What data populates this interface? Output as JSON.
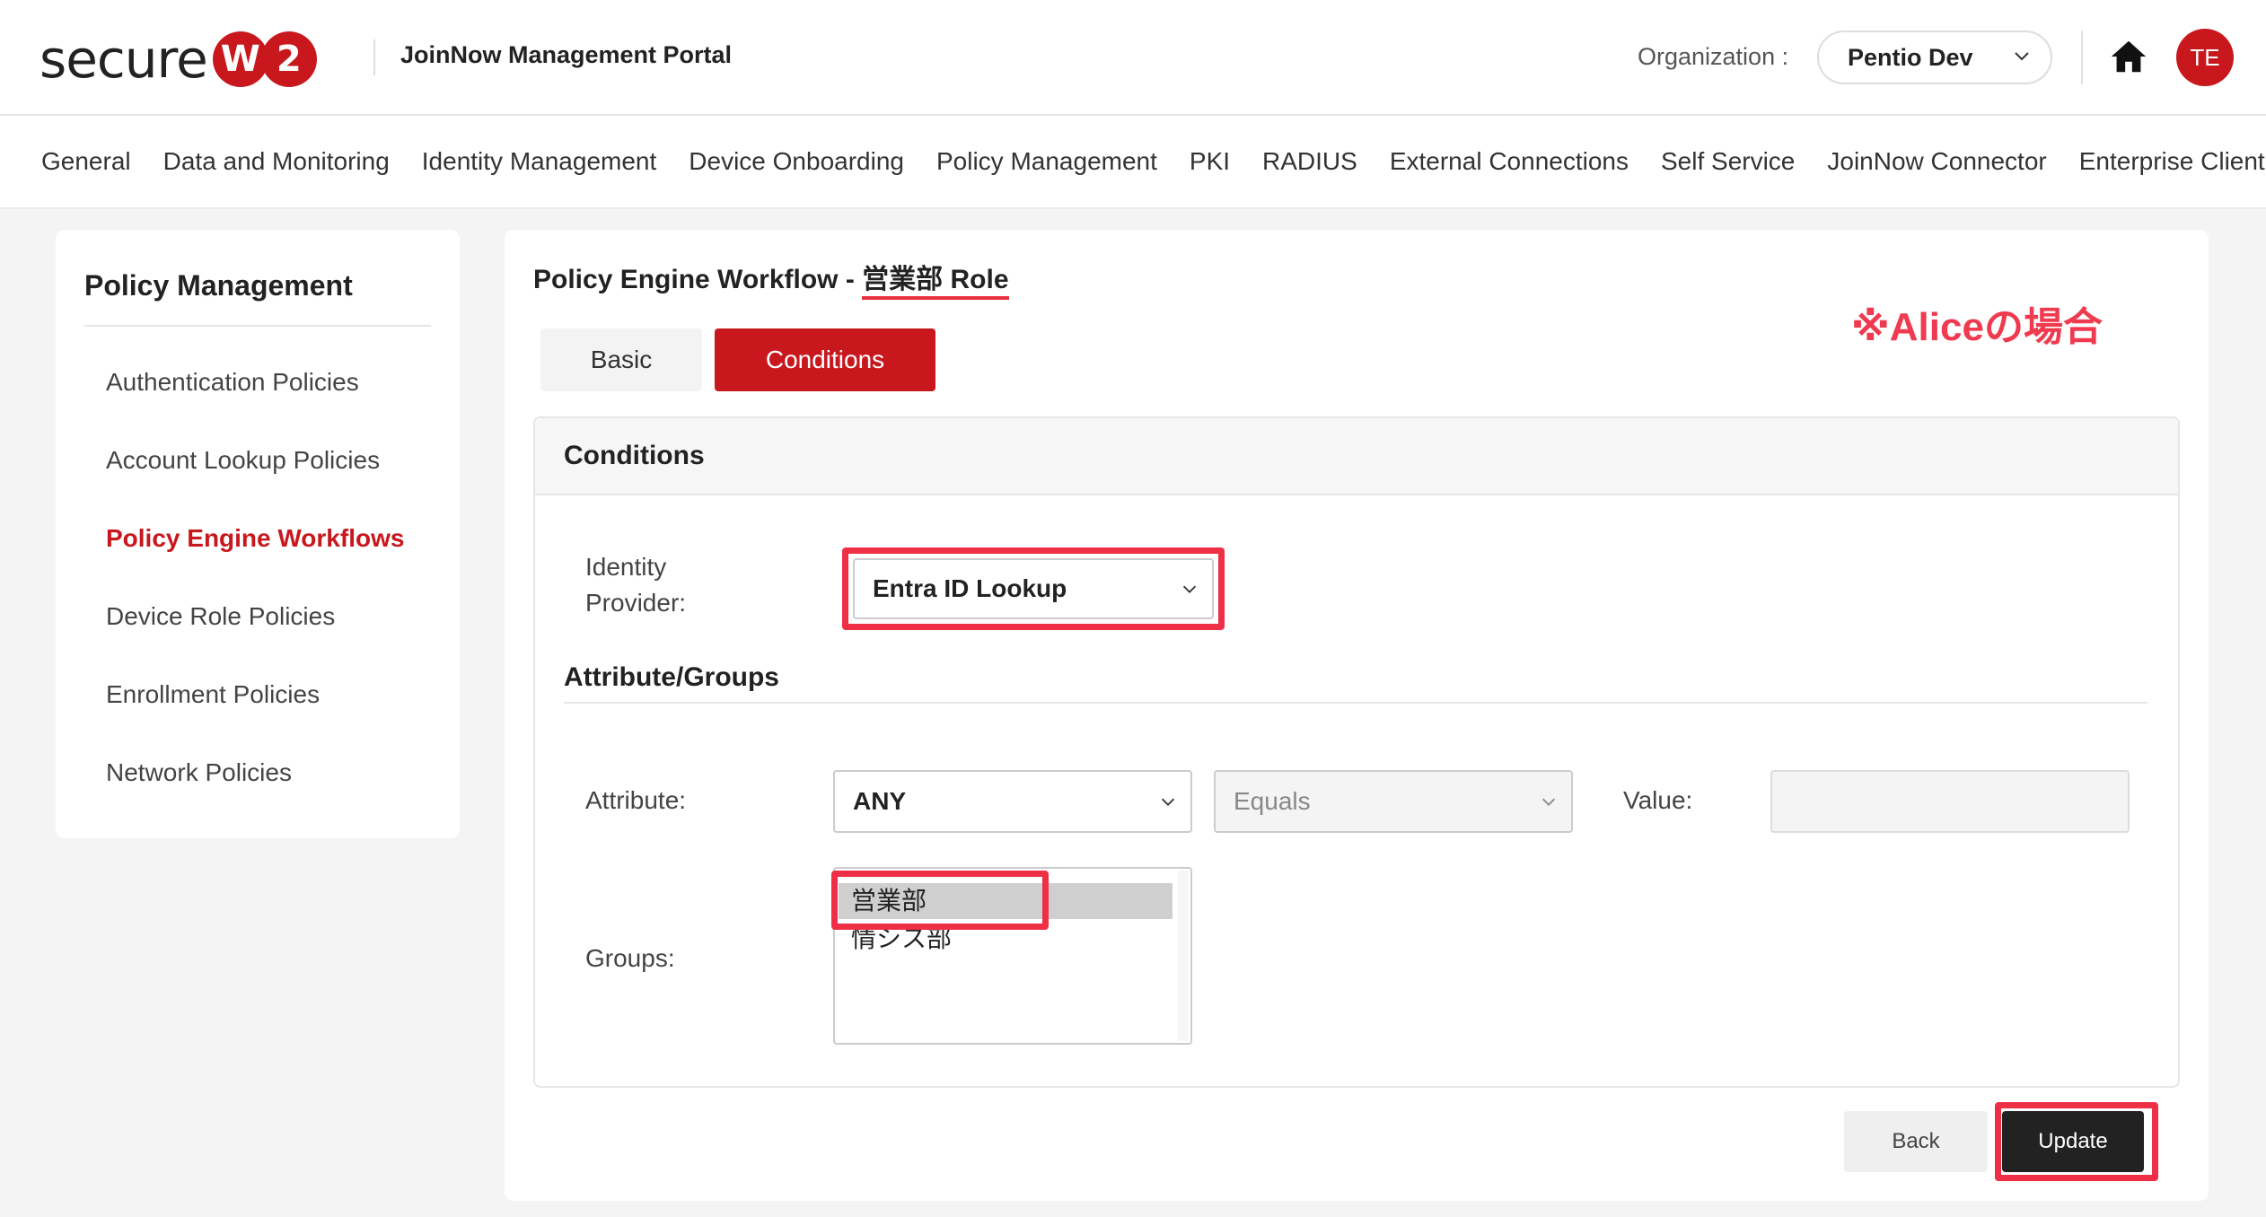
{
  "header": {
    "logo_text": "secure",
    "logo_badge_1": "W",
    "logo_badge_2": "2",
    "portal_title": "JoinNow Management Portal",
    "org_label": "Organization :",
    "org_value": "Pentio Dev",
    "avatar_initials": "TE"
  },
  "nav": {
    "items": [
      "General",
      "Data and Monitoring",
      "Identity Management",
      "Device Onboarding",
      "Policy Management",
      "PKI",
      "RADIUS",
      "External Connections",
      "Self Service",
      "JoinNow Connector",
      "Enterprise Client"
    ]
  },
  "sidebar": {
    "title": "Policy Management",
    "items": [
      {
        "label": "Authentication Policies",
        "active": false
      },
      {
        "label": "Account Lookup Policies",
        "active": false
      },
      {
        "label": "Policy Engine Workflows",
        "active": true
      },
      {
        "label": "Device Role Policies",
        "active": false
      },
      {
        "label": "Enrollment Policies",
        "active": false
      },
      {
        "label": "Network Policies",
        "active": false
      }
    ]
  },
  "main": {
    "title_prefix": "Policy Engine Workflow - ",
    "title_role": "営業部 Role",
    "annotation": "※Aliceの場合",
    "tabs": [
      {
        "label": "Basic",
        "active": false
      },
      {
        "label": "Conditions",
        "active": true
      }
    ],
    "conditions": {
      "heading": "Conditions",
      "identity_provider_label_1": "Identity",
      "identity_provider_label_2": "Provider:",
      "identity_provider_value": "Entra ID Lookup",
      "attr_groups_heading": "Attribute/Groups",
      "attribute_label": "Attribute:",
      "attribute_value": "ANY",
      "operator_value": "Equals",
      "value_label": "Value:",
      "value_input": "",
      "groups_label": "Groups:",
      "groups": [
        {
          "label": "営業部",
          "selected": true
        },
        {
          "label": "情シス部",
          "selected": false
        }
      ]
    },
    "buttons": {
      "back": "Back",
      "update": "Update"
    }
  },
  "colors": {
    "brand_red": "#c8181e",
    "highlight_red": "#ef2f45",
    "annotation_red": "#ef3a4f"
  }
}
